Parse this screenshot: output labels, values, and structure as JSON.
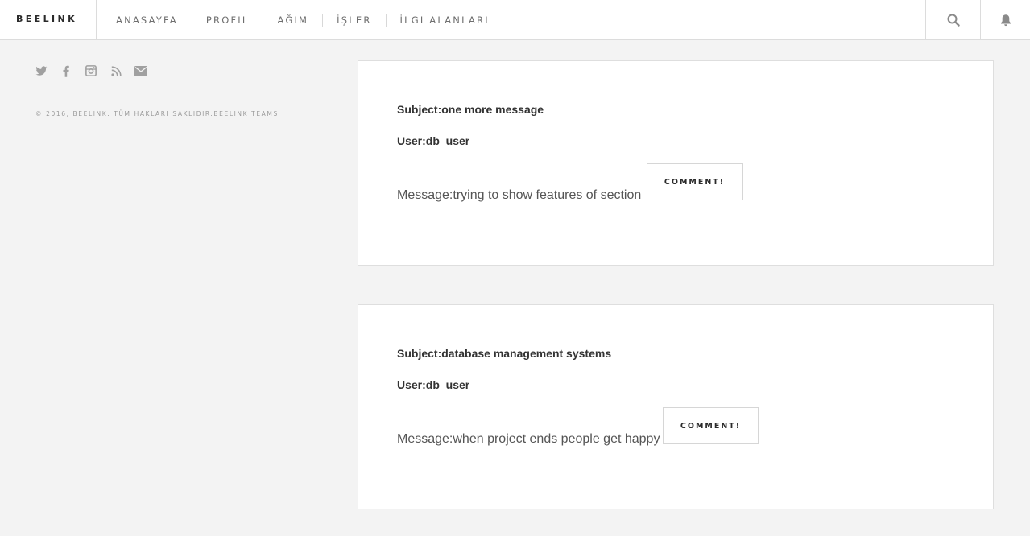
{
  "brand": "BEELINK",
  "nav": {
    "items": [
      "ANASAYFA",
      "PROFIL",
      "AĞIM",
      "İŞLER",
      "İLGI ALANLARI"
    ],
    "icons": [
      "search-icon",
      "bell-icon"
    ]
  },
  "sidebar": {
    "social_icons": [
      "twitter-icon",
      "facebook-icon",
      "instagram-icon",
      "rss-icon",
      "envelope-icon"
    ],
    "copyright_text": "© 2016, BEELINK. TÜM HAKLARI SAKLIDIR.",
    "copyright_link": "BEELINK TEAMS"
  },
  "messages": [
    {
      "subject": "Subject:one more message",
      "user": "User:db_user",
      "message": "Message:trying to show features of section",
      "button": "COMMENT!"
    },
    {
      "subject": "Subject:database management systems",
      "user": "User:db_user",
      "message": "Message:when project ends people get happy",
      "button": "COMMENT!"
    }
  ],
  "colors": {
    "background": "#f3f3f3",
    "card": "#ffffff",
    "text": "#333333",
    "muted": "#9a9a9a",
    "border": "#dcdcdc"
  }
}
